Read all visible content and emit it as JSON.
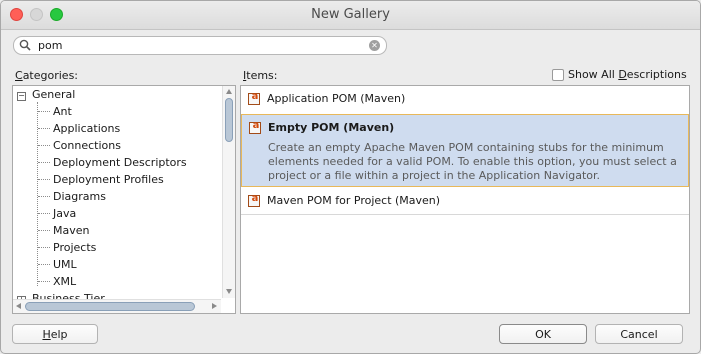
{
  "window": {
    "title": "New Gallery"
  },
  "search": {
    "value": "pom"
  },
  "categories": {
    "label": "Categories:",
    "tree": [
      {
        "label": "General",
        "expanded": true
      },
      {
        "label": "Ant"
      },
      {
        "label": "Applications"
      },
      {
        "label": "Connections"
      },
      {
        "label": "Deployment Descriptors"
      },
      {
        "label": "Deployment Profiles"
      },
      {
        "label": "Diagrams"
      },
      {
        "label": "Java"
      },
      {
        "label": "Maven"
      },
      {
        "label": "Projects"
      },
      {
        "label": "UML"
      },
      {
        "label": "XML"
      },
      {
        "label": "Business Tier",
        "expanded": false
      }
    ]
  },
  "items": {
    "label": "Items:",
    "show_all_label": "Show All Descriptions",
    "show_all_checked": false,
    "list": [
      {
        "name": "Application POM (Maven)",
        "selected": false
      },
      {
        "name": "Empty POM (Maven)",
        "selected": true,
        "description": "Create an empty Apache Maven POM containing stubs for the minimum elements needed for a valid POM. To enable this option, you must select a project or a file within a project in the Application Navigator."
      },
      {
        "name": "Maven POM for Project (Maven)",
        "selected": false
      }
    ]
  },
  "buttons": {
    "help": "Help",
    "ok": "OK",
    "cancel": "Cancel"
  },
  "icons": {
    "item_icon": "maven-a-icon",
    "search": "search-icon",
    "clear": "clear-icon"
  }
}
